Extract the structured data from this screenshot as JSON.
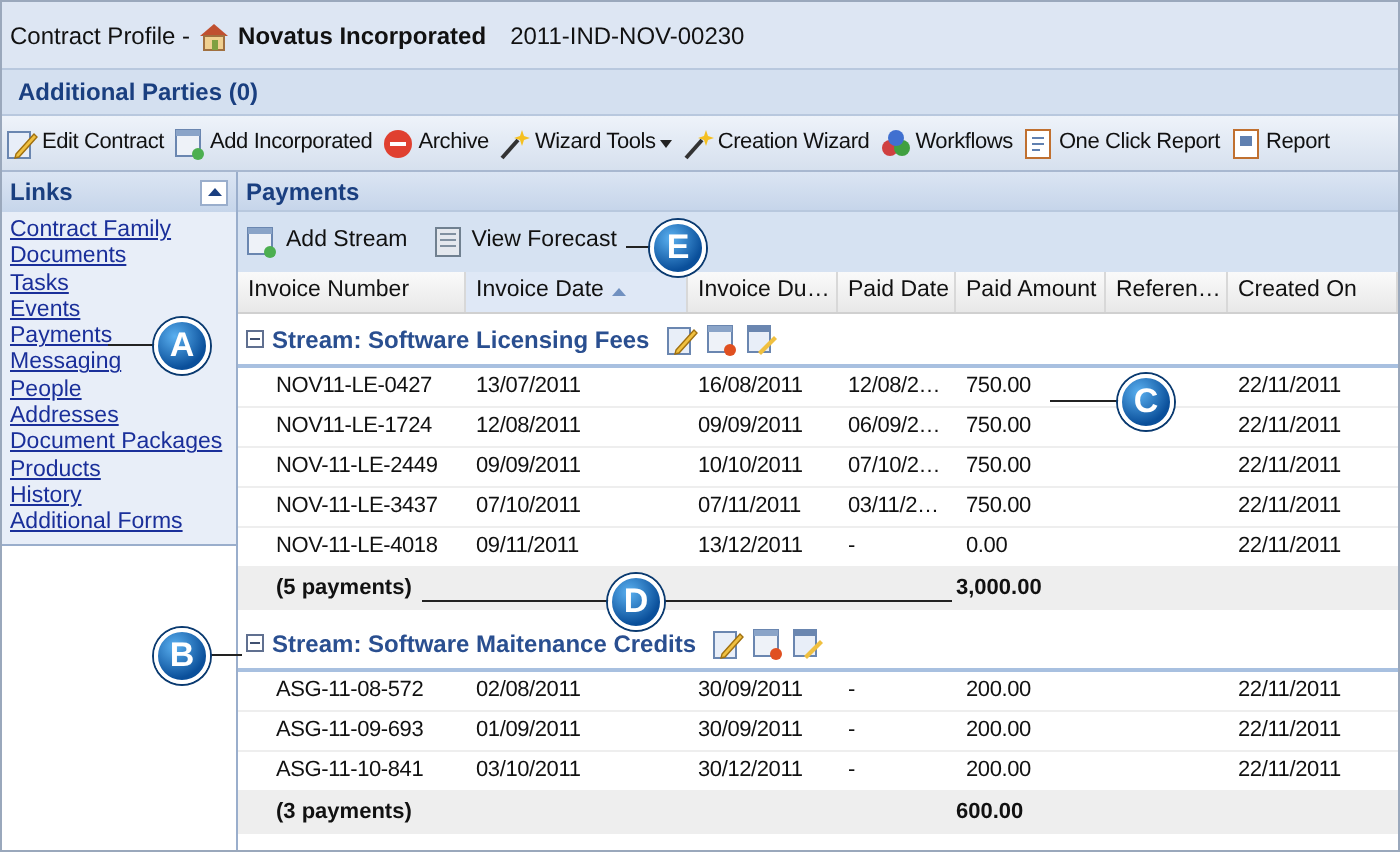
{
  "header": {
    "prefix": "Contract Profile -",
    "company": "Novatus Incorporated",
    "contract_id": "2011-IND-NOV-00230"
  },
  "additional_parties": {
    "title": "Additional Parties (0)"
  },
  "toolbar": [
    {
      "label": "Edit Contract",
      "kind": "edit"
    },
    {
      "label": "Add Incorporated",
      "kind": "add"
    },
    {
      "label": "Archive",
      "kind": "archive"
    },
    {
      "label": "Wizard Tools",
      "kind": "wand",
      "dropdown": true
    },
    {
      "label": "Creation Wizard",
      "kind": "wand",
      "dropdown": false
    },
    {
      "label": "Workflows",
      "kind": "workflow"
    },
    {
      "label": "One Click Report",
      "kind": "report"
    },
    {
      "label": "Report",
      "kind": "report2"
    }
  ],
  "sidebar": {
    "title": "Links",
    "expanded": true,
    "items": [
      "Contract Family",
      "Documents",
      "Tasks",
      "Events",
      "Payments",
      "Messaging",
      "People",
      "Addresses",
      "Document Packages",
      "Products",
      "History",
      "Additional Forms"
    ]
  },
  "payments": {
    "title": "Payments",
    "actions": [
      {
        "label": "Add Stream",
        "kind": "add"
      },
      {
        "label": "View Forecast",
        "kind": "forecast"
      }
    ],
    "columns": [
      {
        "label": "Invoice Number",
        "sorted": false
      },
      {
        "label": "Invoice Date",
        "sorted": true
      },
      {
        "label": "Invoice Du…",
        "sorted": false
      },
      {
        "label": "Paid Date",
        "sorted": false
      },
      {
        "label": "Paid Amount",
        "sorted": false
      },
      {
        "label": "Referen…",
        "sorted": false
      },
      {
        "label": "Created On",
        "sorted": false
      }
    ],
    "streams": [
      {
        "name": "Stream: Software Licensing Fees",
        "expanded": true,
        "rows": [
          [
            "NOV11-LE-0427",
            "13/07/2011",
            "16/08/2011",
            "12/08/2…",
            "750.00",
            "",
            "22/11/2011"
          ],
          [
            "NOV11-LE-1724",
            "12/08/2011",
            "09/09/2011",
            "06/09/2…",
            "750.00",
            "",
            "22/11/2011"
          ],
          [
            "NOV-11-LE-2449",
            "09/09/2011",
            "10/10/2011",
            "07/10/2…",
            "750.00",
            "",
            "22/11/2011"
          ],
          [
            "NOV-11-LE-3437",
            "07/10/2011",
            "07/11/2011",
            "03/11/2…",
            "750.00",
            "",
            "22/11/2011"
          ],
          [
            "NOV-11-LE-4018",
            "09/11/2011",
            "13/12/2011",
            "-",
            "0.00",
            "",
            "22/11/2011"
          ]
        ],
        "summary": {
          "count": "(5 payments)",
          "total": "3,000.00"
        }
      },
      {
        "name": "Stream: Software Maitenance Credits",
        "expanded": true,
        "rows": [
          [
            "ASG-11-08-572",
            "02/08/2011",
            "30/09/2011",
            "-",
            "200.00",
            "",
            "22/11/2011"
          ],
          [
            "ASG-11-09-693",
            "01/09/2011",
            "30/09/2011",
            "-",
            "200.00",
            "",
            "22/11/2011"
          ],
          [
            "ASG-11-10-841",
            "03/10/2011",
            "30/12/2011",
            "-",
            "200.00",
            "",
            "22/11/2011"
          ]
        ],
        "summary": {
          "count": "(3 payments)",
          "total": "600.00"
        }
      }
    ]
  },
  "callouts": [
    "A",
    "B",
    "C",
    "D",
    "E"
  ]
}
